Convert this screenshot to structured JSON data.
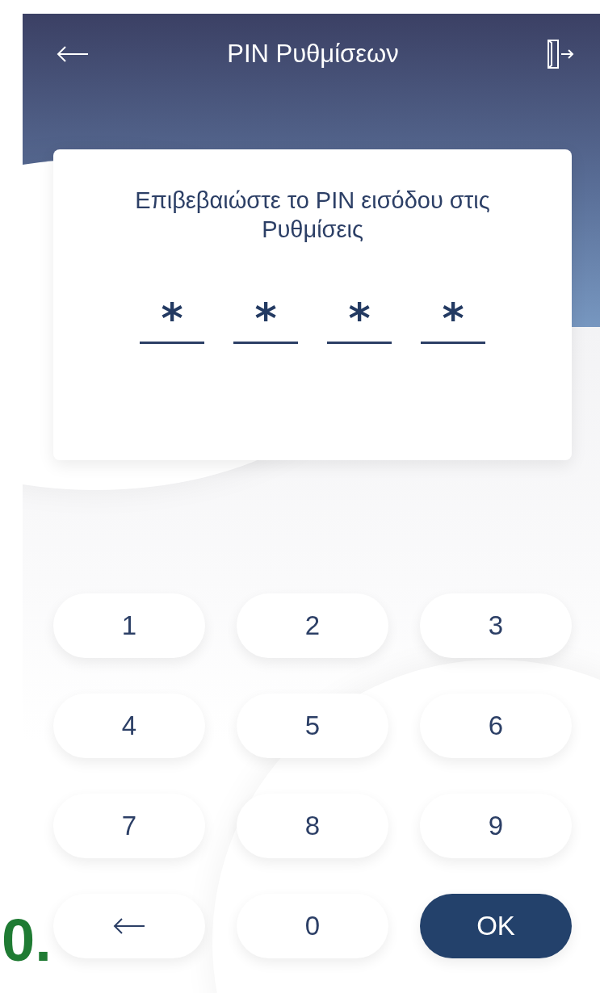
{
  "header": {
    "title": "PIN Ρυθμίσεων"
  },
  "prompt": "Επιβεβαιώστε το PIN εισόδου στις Ρυθμίσεις",
  "pin_slots": [
    {
      "value": "*"
    },
    {
      "value": "*"
    },
    {
      "value": "*"
    },
    {
      "value": "*"
    }
  ],
  "keypad": [
    {
      "kind": "digit",
      "label": "1"
    },
    {
      "kind": "digit",
      "label": "2"
    },
    {
      "kind": "digit",
      "label": "3"
    },
    {
      "kind": "digit",
      "label": "4"
    },
    {
      "kind": "digit",
      "label": "5"
    },
    {
      "kind": "digit",
      "label": "6"
    },
    {
      "kind": "digit",
      "label": "7"
    },
    {
      "kind": "digit",
      "label": "8"
    },
    {
      "kind": "digit",
      "label": "9"
    },
    {
      "kind": "backspace"
    },
    {
      "kind": "digit",
      "label": "0"
    },
    {
      "kind": "ok",
      "label": "OK"
    }
  ],
  "annotation": "0."
}
